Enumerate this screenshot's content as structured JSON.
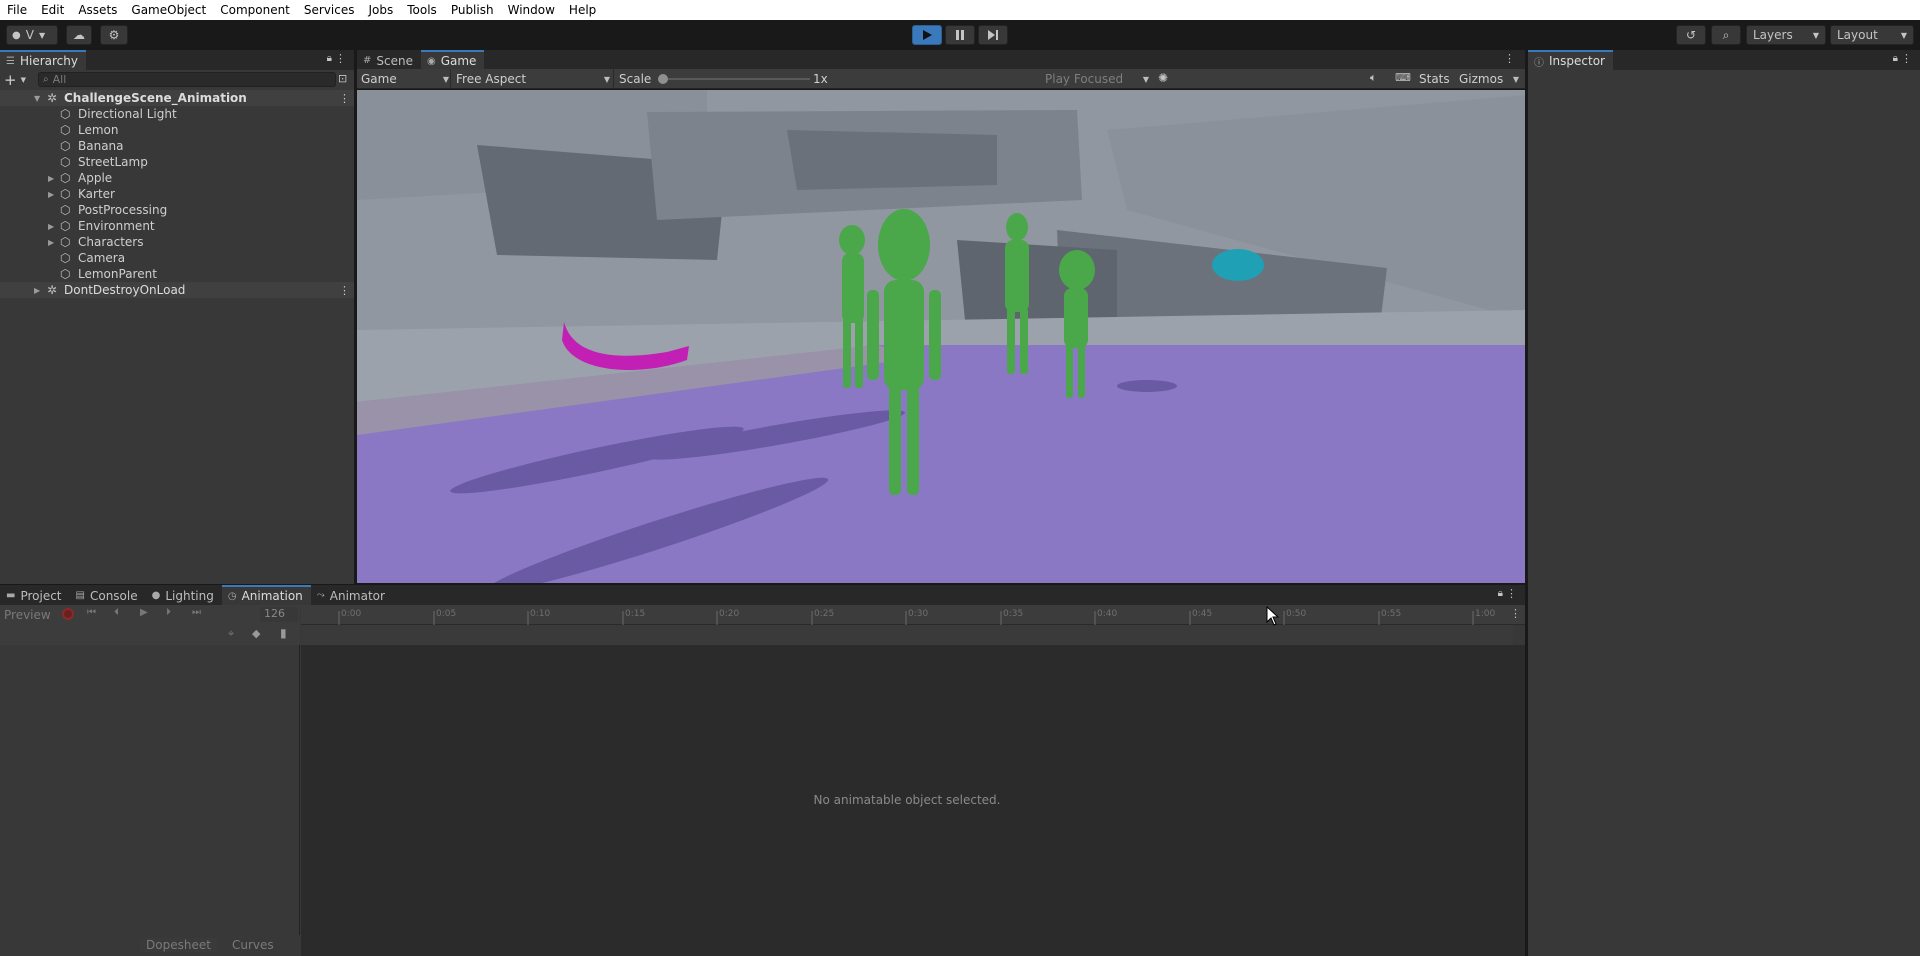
{
  "menubar": [
    "File",
    "Edit",
    "Assets",
    "GameObject",
    "Component",
    "Services",
    "Jobs",
    "Tools",
    "Publish",
    "Window",
    "Help"
  ],
  "toolbar": {
    "account_label": "V",
    "layers_label": "Layers",
    "layout_label": "Layout"
  },
  "hierarchy": {
    "tab_label": "Hierarchy",
    "search_placeholder": "All",
    "scene_name": "ChallengeScene_Animation",
    "items": [
      {
        "label": "Directional Light",
        "expandable": false
      },
      {
        "label": "Lemon",
        "expandable": false
      },
      {
        "label": "Banana",
        "expandable": false
      },
      {
        "label": "StreetLamp",
        "expandable": false
      },
      {
        "label": "Apple",
        "expandable": true
      },
      {
        "label": "Karter",
        "expandable": true
      },
      {
        "label": "PostProcessing",
        "expandable": false
      },
      {
        "label": "Environment",
        "expandable": true
      },
      {
        "label": "Characters",
        "expandable": true
      },
      {
        "label": "Camera",
        "expandable": false
      },
      {
        "label": "LemonParent",
        "expandable": false
      }
    ],
    "dont_destroy": "DontDestroyOnLoad"
  },
  "center_tabs": {
    "scene": "Scene",
    "game": "Game"
  },
  "game_toolbar": {
    "display": "Game",
    "aspect": "Free Aspect",
    "scale_label": "Scale",
    "scale_value": "1x",
    "play_mode": "Play Focused",
    "stats": "Stats",
    "gizmos": "Gizmos"
  },
  "inspector": {
    "tab_label": "Inspector"
  },
  "bottom_tabs": {
    "project": "Project",
    "console": "Console",
    "lighting": "Lighting",
    "animation": "Animation",
    "animator": "Animator"
  },
  "animation": {
    "preview_label": "Preview",
    "frame_value": "126",
    "timeline_labels": [
      "0:00",
      "0:05",
      "0:10",
      "0:15",
      "0:20",
      "0:25",
      "0:30",
      "0:35",
      "0:40",
      "0:45",
      "0:50",
      "0:55",
      "1:00"
    ],
    "empty_message": "No animatable object selected.",
    "dopesheet_label": "Dopesheet",
    "curves_label": "Curves"
  },
  "colors": {
    "accent": "#3a79bb",
    "floor": "#8a78c4",
    "characters": "#4aa84a",
    "banana": "#c21fb5",
    "lemon": "#1fa0b5"
  }
}
